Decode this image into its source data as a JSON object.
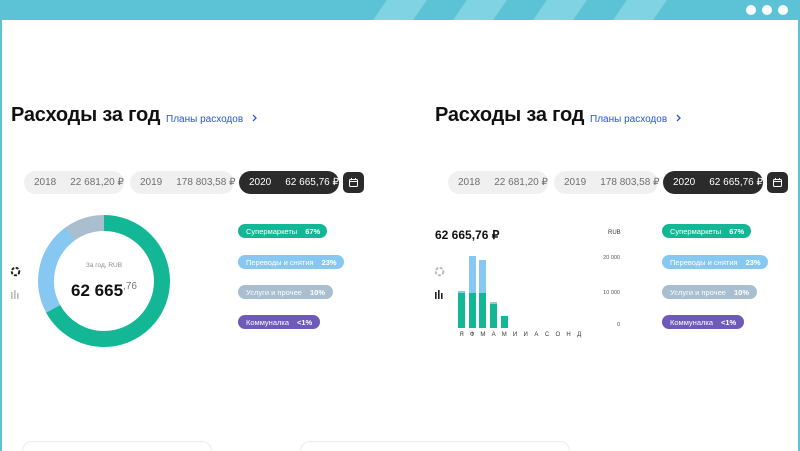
{
  "colors": {
    "green": "#14b795",
    "light_blue": "#86c8f2",
    "grey_blue": "#a9bfcf",
    "purple": "#6e5ab8",
    "dark": "#2b2b2b",
    "link": "#2a55d6"
  },
  "left": {
    "title": "Расходы за год",
    "plans_link": "Планы расходов",
    "years": [
      {
        "year": "2018",
        "amount": "22 681,20 ₽"
      },
      {
        "year": "2019",
        "amount": "178 803,58 ₽"
      },
      {
        "year": "2020",
        "amount": "62 665,76 ₽",
        "active": true
      }
    ],
    "calendar_icon": "calendar-icon",
    "donut": {
      "caption": "За год, RUB",
      "value_main": "62 665",
      "value_kop": ",76",
      "segments": [
        {
          "name": "Супермаркеты",
          "percent": 67,
          "color": "#14b795"
        },
        {
          "name": "Переводы и снятия",
          "percent": 23,
          "color": "#86c8f2"
        },
        {
          "name": "Услуги и прочее",
          "percent": 10,
          "color": "#a9bfcf"
        }
      ]
    },
    "legend": [
      {
        "label": "Супермаркеты",
        "pct": "67%",
        "color": "#14b795"
      },
      {
        "label": "Переводы и снятия",
        "pct": "23%",
        "color": "#86c8f2"
      },
      {
        "label": "Услуги и прочее",
        "pct": "10%",
        "color": "#a9bfcf"
      },
      {
        "label": "Коммуналка",
        "pct": "<1%",
        "color": "#6e5ab8"
      }
    ]
  },
  "right": {
    "title": "Расходы за год",
    "plans_link": "Планы расходов",
    "years": [
      {
        "year": "2018",
        "amount": "22 681,20 ₽"
      },
      {
        "year": "2019",
        "amount": "178 803,58 ₽"
      },
      {
        "year": "2020",
        "amount": "62 665,76 ₽",
        "active": true
      }
    ],
    "total": "62 665,76 ₽",
    "legend": [
      {
        "label": "Супермаркеты",
        "pct": "67%",
        "color": "#14b795"
      },
      {
        "label": "Переводы и снятия",
        "pct": "23%",
        "color": "#86c8f2"
      },
      {
        "label": "Услуги и прочее",
        "pct": "10%",
        "color": "#a9bfcf"
      },
      {
        "label": "Коммуналка",
        "pct": "<1%",
        "color": "#6e5ab8"
      }
    ]
  },
  "chart_data": {
    "type": "bar",
    "categories": [
      "Я",
      "Ф",
      "М",
      "А",
      "М",
      "И",
      "И",
      "А",
      "С",
      "О",
      "Н",
      "Д"
    ],
    "series": [
      {
        "values": [
          10000,
          10000,
          10000,
          7000,
          3500,
          0,
          0,
          0,
          0,
          0,
          0,
          0
        ],
        "color": "#14b795"
      },
      {
        "values": [
          500,
          10500,
          9500,
          0,
          0,
          0,
          0,
          0,
          0,
          0,
          0,
          0
        ],
        "color": "#86c8f2"
      },
      {
        "values": [
          0,
          0,
          0,
          500,
          0,
          0,
          0,
          0,
          0,
          0,
          0,
          0
        ],
        "color": "#a9bfcf"
      }
    ],
    "ylabel": "RUB",
    "yticks": [
      "20 000",
      "10 000",
      "0"
    ],
    "ylim": [
      0,
      20000
    ]
  }
}
